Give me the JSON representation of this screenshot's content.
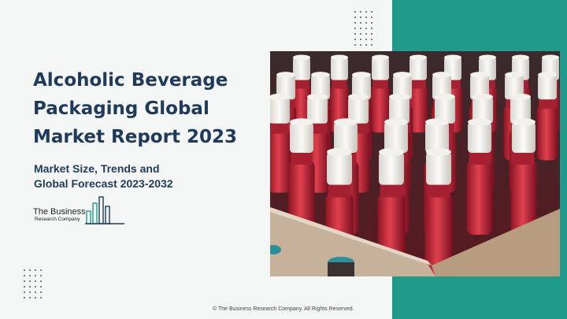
{
  "report": {
    "title_lines": [
      "Alcoholic Beverage",
      "Packaging Global",
      "Market Report 2023"
    ],
    "subtitle_lines": [
      "Market Size, Trends and",
      "Global Forecast 2023-2032"
    ]
  },
  "logo": {
    "line1": "The Business",
    "line2": "Research Company"
  },
  "footer": {
    "copyright": "© The Business Research Company. All Rights Reserved."
  },
  "colors": {
    "accent_teal": "#1f9a8b",
    "title_navy": "#1f3a5a",
    "background": "#f4f5f5"
  },
  "photo": {
    "subject": "wine-bottles-image"
  }
}
